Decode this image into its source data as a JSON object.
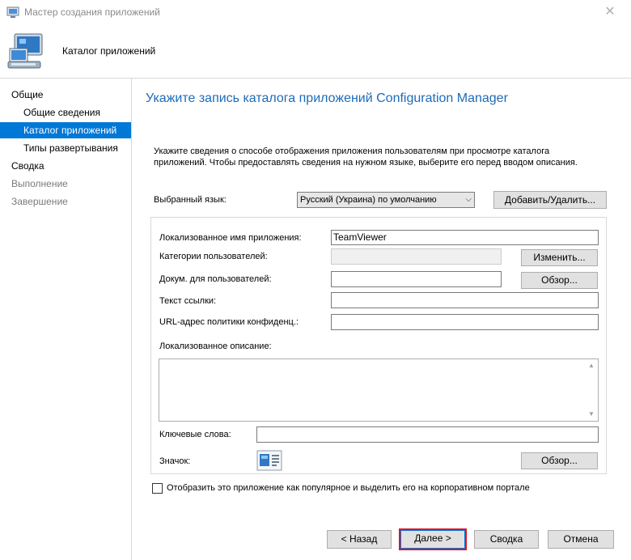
{
  "window": {
    "title": "Мастер создания приложений",
    "close_glyph": "✕"
  },
  "header": {
    "title": "Каталог приложений",
    "icon": "computer-icon"
  },
  "sidebar": {
    "items": [
      {
        "label": "Общие",
        "indent": 0,
        "state": "normal"
      },
      {
        "label": "Общие сведения",
        "indent": 1,
        "state": "normal"
      },
      {
        "label": "Каталог приложений",
        "indent": 1,
        "state": "selected"
      },
      {
        "label": "Типы развертывания",
        "indent": 1,
        "state": "normal"
      },
      {
        "label": "Сводка",
        "indent": 0,
        "state": "normal"
      },
      {
        "label": "Выполнение",
        "indent": 0,
        "state": "disabled"
      },
      {
        "label": "Завершение",
        "indent": 0,
        "state": "disabled"
      }
    ]
  },
  "main": {
    "title": "Укажите запись каталога приложений Configuration Manager",
    "description": "Укажите сведения о способе отображения приложения пользователям при просмотре каталога приложений. Чтобы предоставлять сведения на нужном языке, выберите его перед вводом описания.",
    "language_label": "Выбранный язык:",
    "language_value": "Русский (Украина) по умолчанию",
    "add_remove_button": "Добавить/Удалить...",
    "fields": {
      "app_name_label": "Локализованное имя приложения:",
      "app_name_value": "TeamViewer",
      "categories_label": "Категории пользователей:",
      "categories_value": "",
      "change_button": "Изменить...",
      "docs_label": "Докум. для пользователей:",
      "docs_value": "",
      "browse_button": "Обзор...",
      "link_text_label": "Текст ссылки:",
      "link_text_value": "",
      "privacy_url_label": "URL-адрес политики конфиденц.:",
      "privacy_url_value": "",
      "description_label": "Локализованное описание:",
      "description_value": "",
      "keywords_label": "Ключевые слова:",
      "keywords_value": "",
      "icon_label": "Значок:",
      "icon_browse_button": "Обзор..."
    },
    "featured_checkbox_label": "Отобразить это приложение как популярное и выделить его на корпоративном портале",
    "featured_checked": false
  },
  "footer": {
    "back": "< Назад",
    "next": "Далее >",
    "summary": "Сводка",
    "cancel": "Отмена",
    "highlight_color": "#e81123"
  },
  "colors": {
    "accent": "#0078d7",
    "title_blue": "#1e6bb8"
  }
}
